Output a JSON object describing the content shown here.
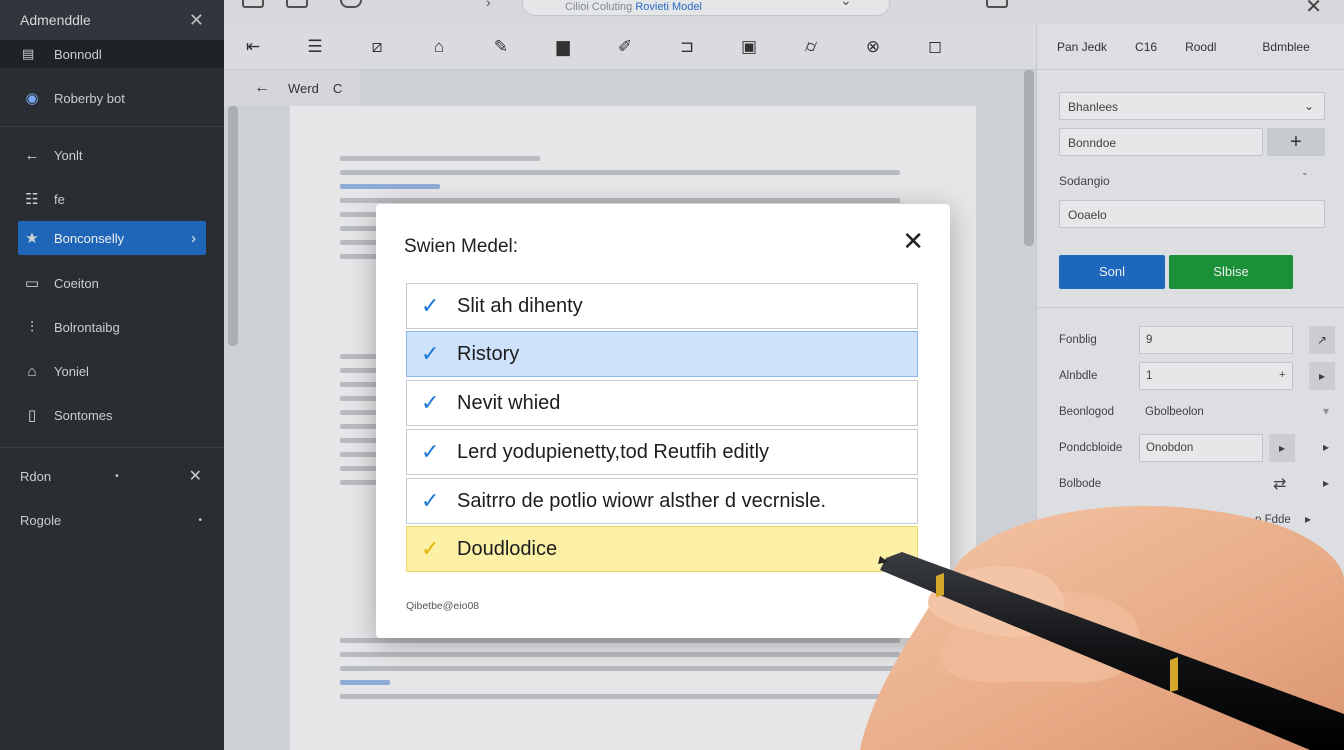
{
  "sidebar": {
    "title": "Admenddle",
    "section": "Bonnodl",
    "items": [
      {
        "label": "Roberby bot",
        "icon": "globe-icon"
      },
      {
        "label": "Yonlt",
        "icon": "arrow-left-icon"
      },
      {
        "label": "fe",
        "icon": "grid-icon"
      },
      {
        "label": "Bonconselly",
        "icon": "star-icon",
        "active": true
      },
      {
        "label": "Coeiton",
        "icon": "folder-icon"
      },
      {
        "label": "Bolrontaibg",
        "icon": "sliders-icon"
      },
      {
        "label": "Yoniel",
        "icon": "home-icon"
      },
      {
        "label": "Sontomes",
        "icon": "document-icon"
      }
    ],
    "footer": [
      {
        "label": "Rdon"
      },
      {
        "label": "Rogole"
      }
    ]
  },
  "topbar": {
    "search_text": "Cilioi Coluting ",
    "search_highlight": "Rovieti Model"
  },
  "doc_nav": {
    "label": "Werd",
    "trailing": "C"
  },
  "modal": {
    "title": "Swien Medel:",
    "options": [
      {
        "label": "Slit ah dihenty",
        "state": "normal"
      },
      {
        "label": "Ristory",
        "state": "selected"
      },
      {
        "label": "Nevit whied",
        "state": "normal"
      },
      {
        "label": "Lerd yodupienetty,tod Reutfih editly",
        "state": "normal"
      },
      {
        "label": "Saitrro de potlio wiowr alsther d vecrnisle.",
        "state": "normal"
      },
      {
        "label": "Doudlodice",
        "state": "warning"
      }
    ],
    "footer": "Qibetbe@eio08"
  },
  "right_panel": {
    "header": [
      "Pan Jedk",
      "C16",
      "Roodl",
      "Bdmblee"
    ],
    "field1": "Bhanlees",
    "field2": "Bonndoe",
    "label1": "Sodangio",
    "field3": "Ooaelo",
    "btn_primary": "Sonl",
    "btn_secondary": "Slbise",
    "props": [
      {
        "key": "Fonblig",
        "value": "9"
      },
      {
        "key": "Alnbdle",
        "value": "1"
      },
      {
        "key": "Beonlogod",
        "value": "Gbolbeolon"
      },
      {
        "key": "Pondcbloide",
        "value": "Onobdon"
      },
      {
        "key": "Bolbode",
        "value": ""
      }
    ],
    "extra_label": "p Fdde"
  },
  "colors": {
    "sidebar_bg": "#2b2f33",
    "accent_blue": "#1f6cc4",
    "accent_green": "#1a9a3a",
    "selected_row": "#cfe2fb",
    "warning_row": "#fbf0a6"
  }
}
